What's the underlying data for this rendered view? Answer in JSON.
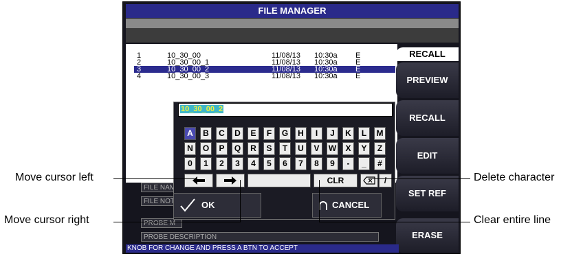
{
  "title": "FILE MANAGER",
  "files": [
    {
      "num": "1",
      "name": "10_30_00",
      "date": "11/08/13",
      "time": "10:30a",
      "flag": "E",
      "selected": false
    },
    {
      "num": "2",
      "name": "10_30_00_1",
      "date": "11/08/13",
      "time": "10:30a",
      "flag": "E",
      "selected": false
    },
    {
      "num": "3",
      "name": "10_30_00_2",
      "date": "11/08/13",
      "time": "10:30a",
      "flag": "E",
      "selected": true
    },
    {
      "num": "4",
      "name": "10_30_00_3",
      "date": "11/08/13",
      "time": "10:30a",
      "flag": "E",
      "selected": false
    }
  ],
  "side_buttons": {
    "recall_tab": "RECALL",
    "preview": "PREVIEW",
    "recall": "RECALL",
    "edit": "EDIT",
    "set_ref": "SET REF",
    "erase": "ERASE"
  },
  "name_field": {
    "value": "10_30_00_2"
  },
  "keyboard": {
    "row1": [
      "A",
      "B",
      "C",
      "D",
      "E",
      "F",
      "G",
      "H",
      "I",
      "J",
      "K",
      "L",
      "M"
    ],
    "row2": [
      "N",
      "O",
      "P",
      "Q",
      "R",
      "S",
      "T",
      "U",
      "V",
      "W",
      "X",
      "Y",
      "Z"
    ],
    "row3": [
      "0",
      "1",
      "2",
      "3",
      "4",
      "5",
      "6",
      "7",
      "8",
      "9",
      "-",
      "_",
      "#"
    ],
    "selected_key": "A",
    "clr": "CLR",
    "slash": "/",
    "ok": "OK",
    "cancel": "CANCEL"
  },
  "fields": {
    "file_name": "FILE NAM",
    "file_notes": "FILE NOT",
    "probe_model": "PROBE M",
    "probe_description": "PROBE DESCRIPTION"
  },
  "status": "KNOB FOR CHANGE AND PRESS A BTN TO ACCEPT",
  "callouts": {
    "cursor_left": "Move cursor left",
    "cursor_right": "Move cursor right",
    "delete_char": "Delete character",
    "clear_line": "Clear entire line"
  },
  "colors": {
    "title_bar": "#2a2a8a",
    "selection": "#2b2b8e",
    "text_highlight": "#3fb6c9"
  }
}
